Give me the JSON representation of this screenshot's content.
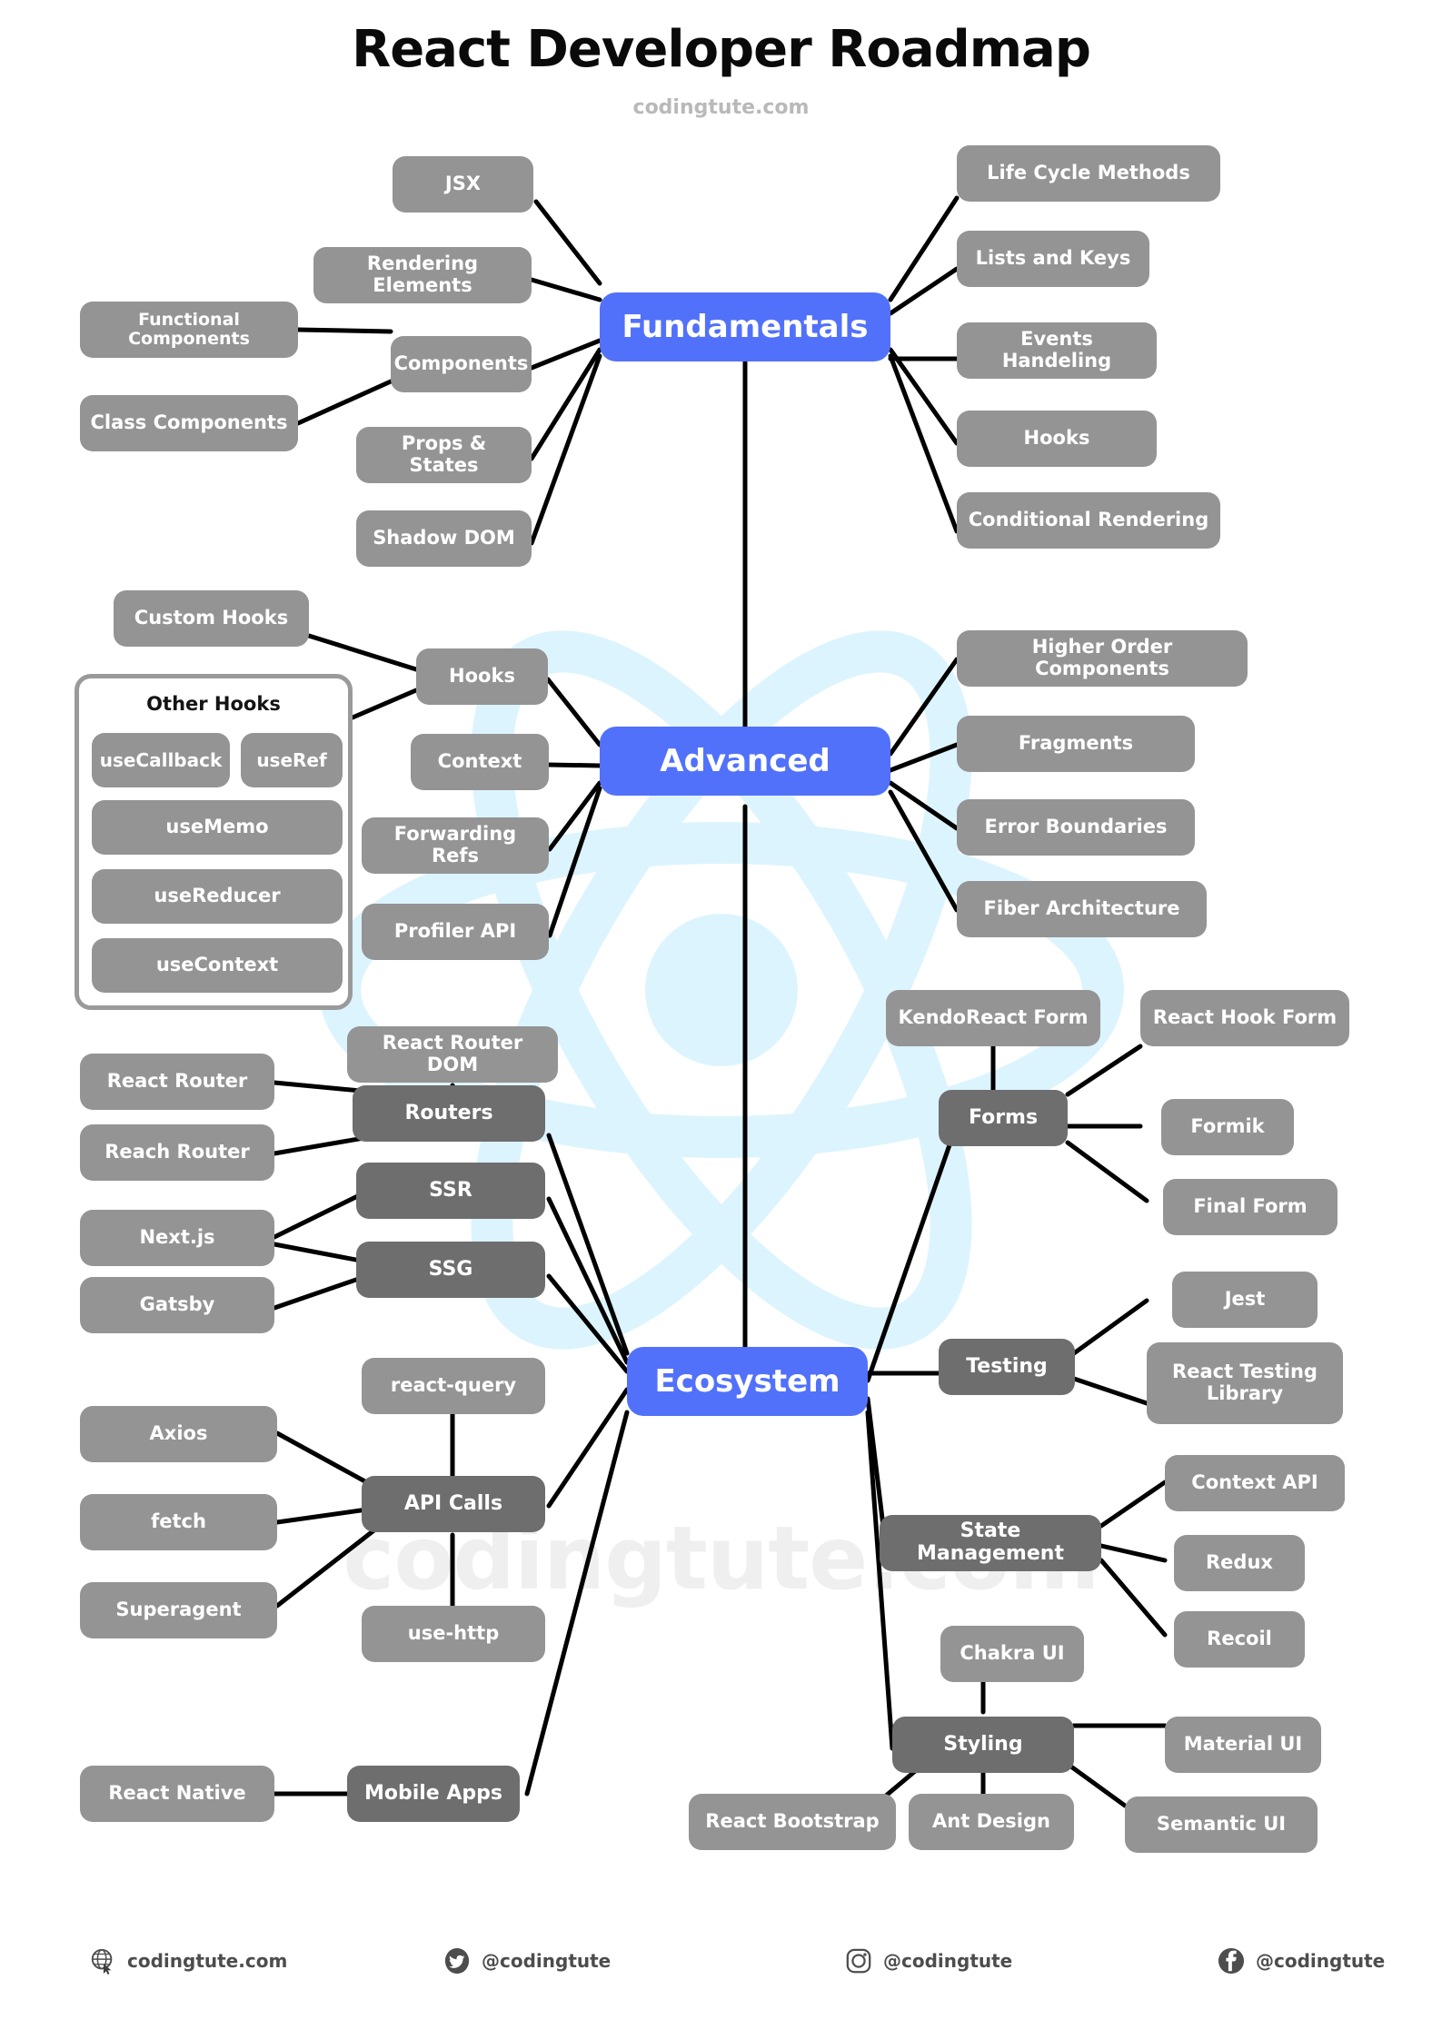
{
  "header": {
    "title": "React Developer Roadmap",
    "subtitle": "codingtute.com"
  },
  "watermark": {
    "text": "codingtute.com",
    "logo": "react-atom-logo"
  },
  "colors": {
    "hub": "#5271FA",
    "branch": "#6E6E6E",
    "leaf": "#949494",
    "edge": "#000000",
    "watermark": "#EFEFEF",
    "atom": "#DCF4FD"
  },
  "hubs": {
    "fundamentals": "Fundamentals",
    "advanced": "Advanced",
    "ecosystem": "Ecosystem"
  },
  "fundamentals": {
    "left": [
      "JSX",
      "Rendering Elements",
      "Components",
      "Props & States",
      "Shadow DOM"
    ],
    "components_children": [
      "Functional Components",
      "Class Components"
    ],
    "right": [
      "Life Cycle Methods",
      "Lists and Keys",
      "Events Handeling",
      "Hooks",
      "Conditional Rendering"
    ]
  },
  "advanced": {
    "left": [
      "Hooks",
      "Context",
      "Forwarding Refs",
      "Profiler API"
    ],
    "custom_hooks": "Custom Hooks",
    "other_hooks": {
      "title": "Other Hooks",
      "items": [
        "useCallback",
        "useRef",
        "useMemo",
        "useReducer",
        "useContext"
      ]
    },
    "right": [
      "Higher Order Components",
      "Fragments",
      "Error Boundaries",
      "Fiber Architecture"
    ]
  },
  "ecosystem": {
    "routers": {
      "label": "Routers",
      "top": "React Router DOM",
      "children": [
        "React Router",
        "Reach Router"
      ]
    },
    "ssr": {
      "label": "SSR",
      "children": [
        "Next.js"
      ]
    },
    "ssg": {
      "label": "SSG",
      "children": [
        "Next.js",
        "Gatsby"
      ]
    },
    "next_js": "Next.js",
    "gatsby": "Gatsby",
    "api_calls": {
      "label": "API Calls",
      "top": "react-query",
      "bottom": "use-http",
      "children": [
        "Axios",
        "fetch",
        "Superagent"
      ]
    },
    "mobile_apps": {
      "label": "Mobile Apps",
      "children": [
        "React Native"
      ]
    },
    "forms": {
      "label": "Forms",
      "top": "KendoReact Form",
      "children": [
        "React Hook Form",
        "Formik",
        "Final Form"
      ]
    },
    "testing": {
      "label": "Testing",
      "children": [
        "Jest",
        "React Testing Library"
      ]
    },
    "state_management": {
      "label": "State Management",
      "children": [
        "Context API",
        "Redux",
        "Recoil"
      ]
    },
    "styling": {
      "label": "Styling",
      "top": "Chakra UI",
      "children": [
        "Material UI",
        "React Bootstrap",
        "Ant Design",
        "Semantic UI"
      ]
    }
  },
  "footer": [
    {
      "icon": "globe-icon",
      "label": "codingtute.com"
    },
    {
      "icon": "twitter-icon",
      "label": "@codingtute"
    },
    {
      "icon": "instagram-icon",
      "label": "@codingtute"
    },
    {
      "icon": "facebook-icon",
      "label": "@codingtute"
    }
  ]
}
